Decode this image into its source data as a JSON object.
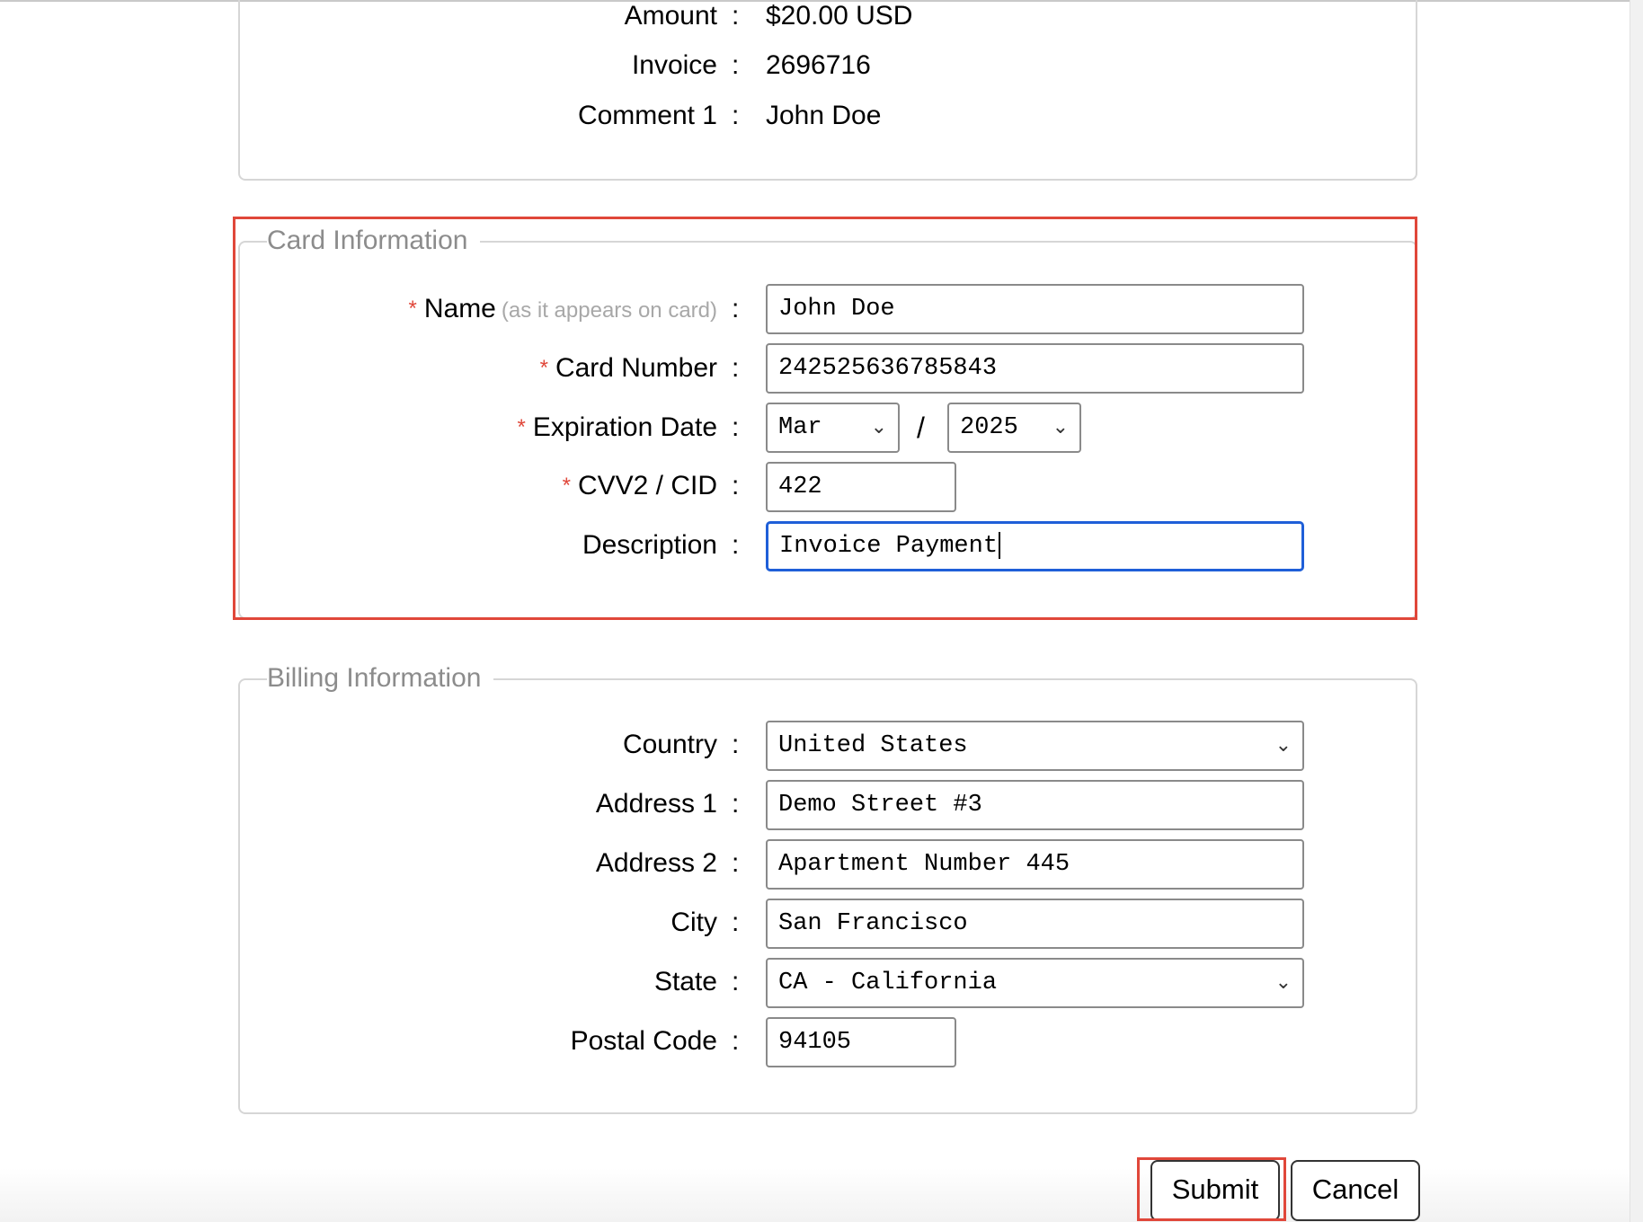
{
  "summary": {
    "rows": [
      {
        "label": "Amount",
        "value": "$20.00 USD"
      },
      {
        "label": "Invoice",
        "value": "2696716"
      },
      {
        "label": "Comment 1",
        "value": "John Doe"
      }
    ]
  },
  "card": {
    "legend": "Card Information",
    "required_mark": "*",
    "name_label": "Name",
    "name_hint": "(as it appears on card)",
    "name_value": "John Doe",
    "number_label": "Card Number",
    "number_value": "242525636785843",
    "exp_label": "Expiration Date",
    "exp_month": "Mar",
    "exp_separator": "/",
    "exp_year": "2025",
    "cvv_label": "CVV2 / CID",
    "cvv_value": "422",
    "desc_label": "Description",
    "desc_value": "Invoice Payment"
  },
  "billing": {
    "legend": "Billing Information",
    "country_label": "Country",
    "country_value": "United States",
    "address1_label": "Address 1",
    "address1_value": "Demo Street #3",
    "address2_label": "Address 2",
    "address2_value": "Apartment Number 445",
    "city_label": "City",
    "city_value": "San Francisco",
    "state_label": "State",
    "state_value": "CA - California",
    "postal_label": "Postal Code",
    "postal_value": "94105"
  },
  "colon": ":",
  "actions": {
    "submit_label": "Submit",
    "cancel_label": "Cancel"
  },
  "colors": {
    "highlight": "#e0473a",
    "focus": "#1f5fd8",
    "required": "#e0473a"
  },
  "icons": {
    "select_chevron": "chevron-down-icon"
  }
}
